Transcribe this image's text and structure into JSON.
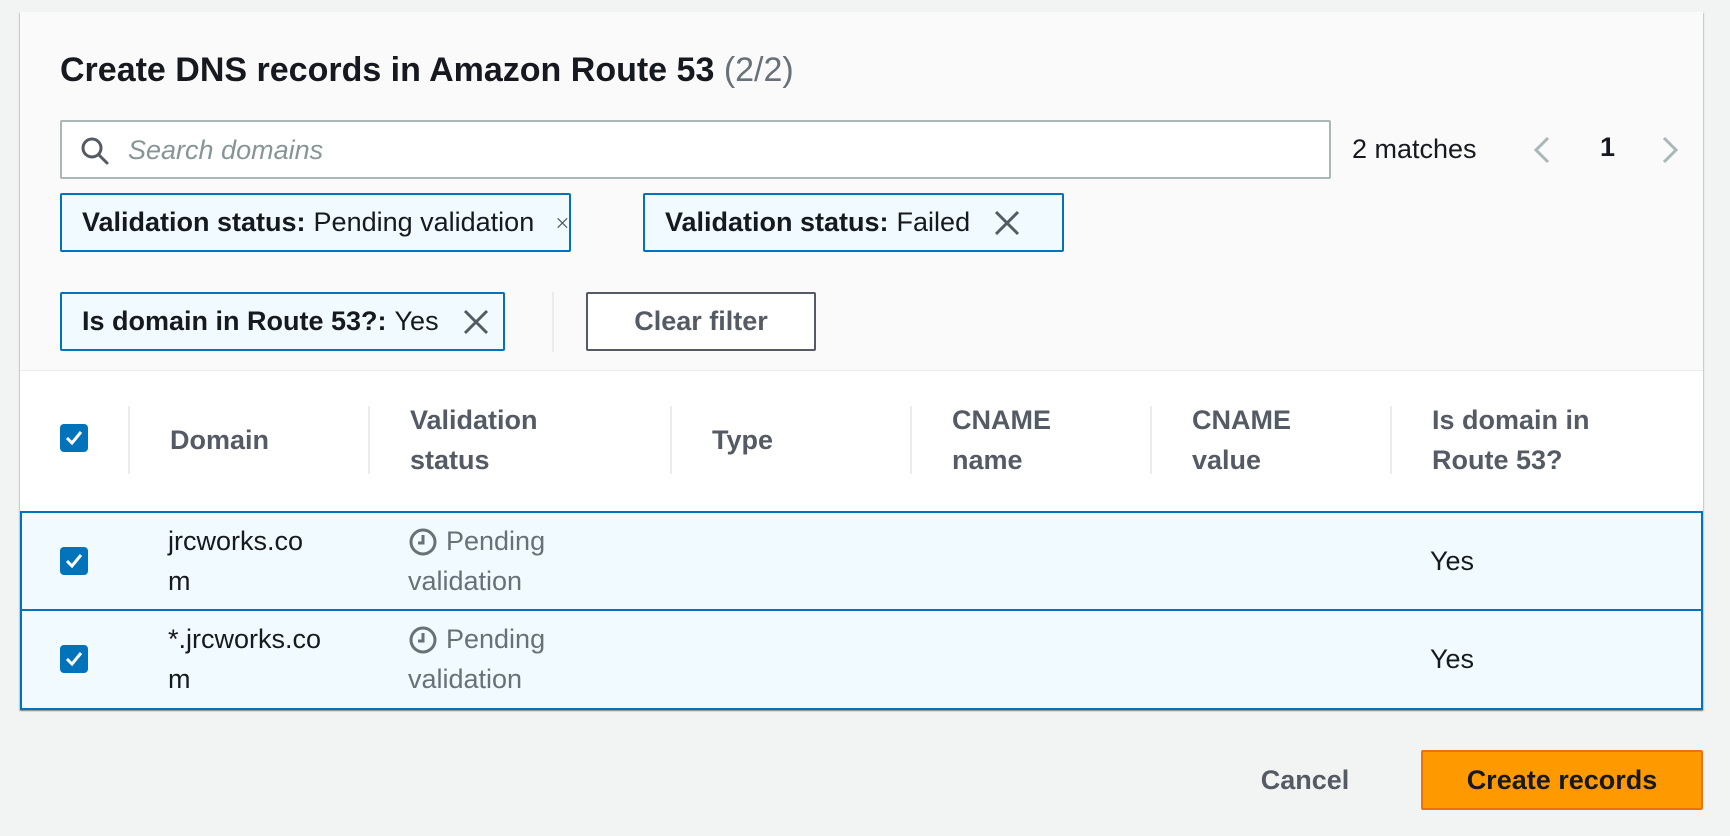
{
  "header": {
    "title": "Create DNS records in Amazon Route 53",
    "count": "(2/2)"
  },
  "search": {
    "placeholder": "Search domains",
    "value": "",
    "matches": "2 matches",
    "page": "1"
  },
  "filters": [
    {
      "key": "Validation status:",
      "value": "Pending validation"
    },
    {
      "key": "Validation status:",
      "value": "Failed"
    },
    {
      "key": "Is domain in Route 53?:",
      "value": "Yes"
    }
  ],
  "clear_filter_label": "Clear filter",
  "table": {
    "columns": [
      {
        "line1": "Domain",
        "line2": ""
      },
      {
        "line1": "Validation",
        "line2": "status"
      },
      {
        "line1": "Type",
        "line2": ""
      },
      {
        "line1": "CNAME",
        "line2": "name"
      },
      {
        "line1": "CNAME",
        "line2": "value"
      },
      {
        "line1": "Is domain in",
        "line2": "Route 53?"
      }
    ],
    "rows": [
      {
        "domain_line1": "jrcworks.co",
        "domain_line2": "m",
        "status_line1": "Pending",
        "status_line2": "validation",
        "type": "",
        "cname_name": "",
        "cname_value": "",
        "in_route53": "Yes",
        "selected": true
      },
      {
        "domain_line1": "*.jrcworks.co",
        "domain_line2": "m",
        "status_line1": "Pending",
        "status_line2": "validation",
        "type": "",
        "cname_name": "",
        "cname_value": "",
        "in_route53": "Yes",
        "selected": true
      }
    ]
  },
  "footer": {
    "cancel_label": "Cancel",
    "create_label": "Create records"
  },
  "icons": {
    "search": "search-icon",
    "remove": "close-icon",
    "prev": "chevron-left-icon",
    "next": "chevron-right-icon",
    "status": "clock-icon",
    "check": "checkmark-icon"
  },
  "colors": {
    "accent": "#0073bb",
    "primary_button": "#ff9900",
    "selected_row_bg": "#f1faff"
  }
}
